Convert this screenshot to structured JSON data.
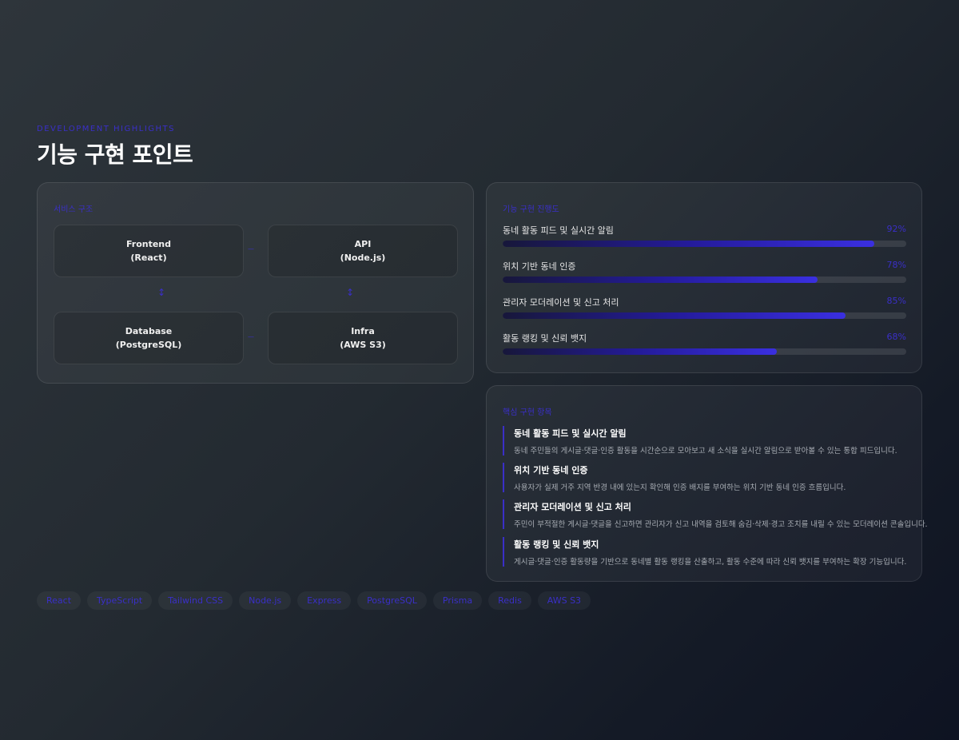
{
  "header": {
    "eyebrow": "DEVELOPMENT HIGHLIGHTS",
    "title": "기능 구현 포인트"
  },
  "architecture": {
    "label": "서비스 구조",
    "nodes": [
      {
        "name": "Frontend",
        "sub": "(React)"
      },
      {
        "name": "API",
        "sub": "(Node.js)"
      },
      {
        "name": "Database",
        "sub": "(PostgreSQL)"
      },
      {
        "name": "Infra",
        "sub": "(AWS S3)"
      }
    ],
    "connector_h": "—",
    "connector_v": "↕"
  },
  "progress": {
    "label": "기능 구현 진행도",
    "items": [
      {
        "name": "동네 활동 피드 및 실시간 알림",
        "value": 92,
        "display": "92%"
      },
      {
        "name": "위치 기반 동네 인증",
        "value": 78,
        "display": "78%"
      },
      {
        "name": "관리자 모더레이션 및 신고 처리",
        "value": 85,
        "display": "85%"
      },
      {
        "name": "활동 랭킹 및 신뢰 뱃지",
        "value": 68,
        "display": "68%"
      }
    ]
  },
  "highlights": {
    "label": "핵심 구현 항목",
    "items": [
      {
        "title": "동네 활동 피드 및 실시간 알림",
        "desc": "동네 주민들의 게시글·댓글·인증 활동을 시간순으로 모아보고 새 소식을 실시간 알림으로 받아볼 수 있는 통합 피드입니다."
      },
      {
        "title": "위치 기반 동네 인증",
        "desc": "사용자가 실제 거주 지역 반경 내에 있는지 확인해 인증 배지를 부여하는 위치 기반 동네 인증 흐름입니다."
      },
      {
        "title": "관리자 모더레이션 및 신고 처리",
        "desc": "주민이 부적절한 게시글·댓글을 신고하면 관리자가 신고 내역을 검토해 숨김·삭제·경고 조치를 내릴 수 있는 모더레이션 콘솔입니다."
      },
      {
        "title": "활동 랭킹 및 신뢰 뱃지",
        "desc": "게시글·댓글·인증 활동량을 기반으로 동네별 활동 랭킹을 산출하고, 활동 수준에 따라 신뢰 뱃지를 부여하는 확장 기능입니다."
      }
    ]
  },
  "stack": [
    "React",
    "TypeScript",
    "Tailwind CSS",
    "Node.js",
    "Express",
    "PostgreSQL",
    "Prisma",
    "Redis",
    "AWS S3"
  ],
  "colors": {
    "accent": "#3a2fc7",
    "background": "#232a31",
    "text": "#e8eaed",
    "muted": "#a7acb3"
  }
}
